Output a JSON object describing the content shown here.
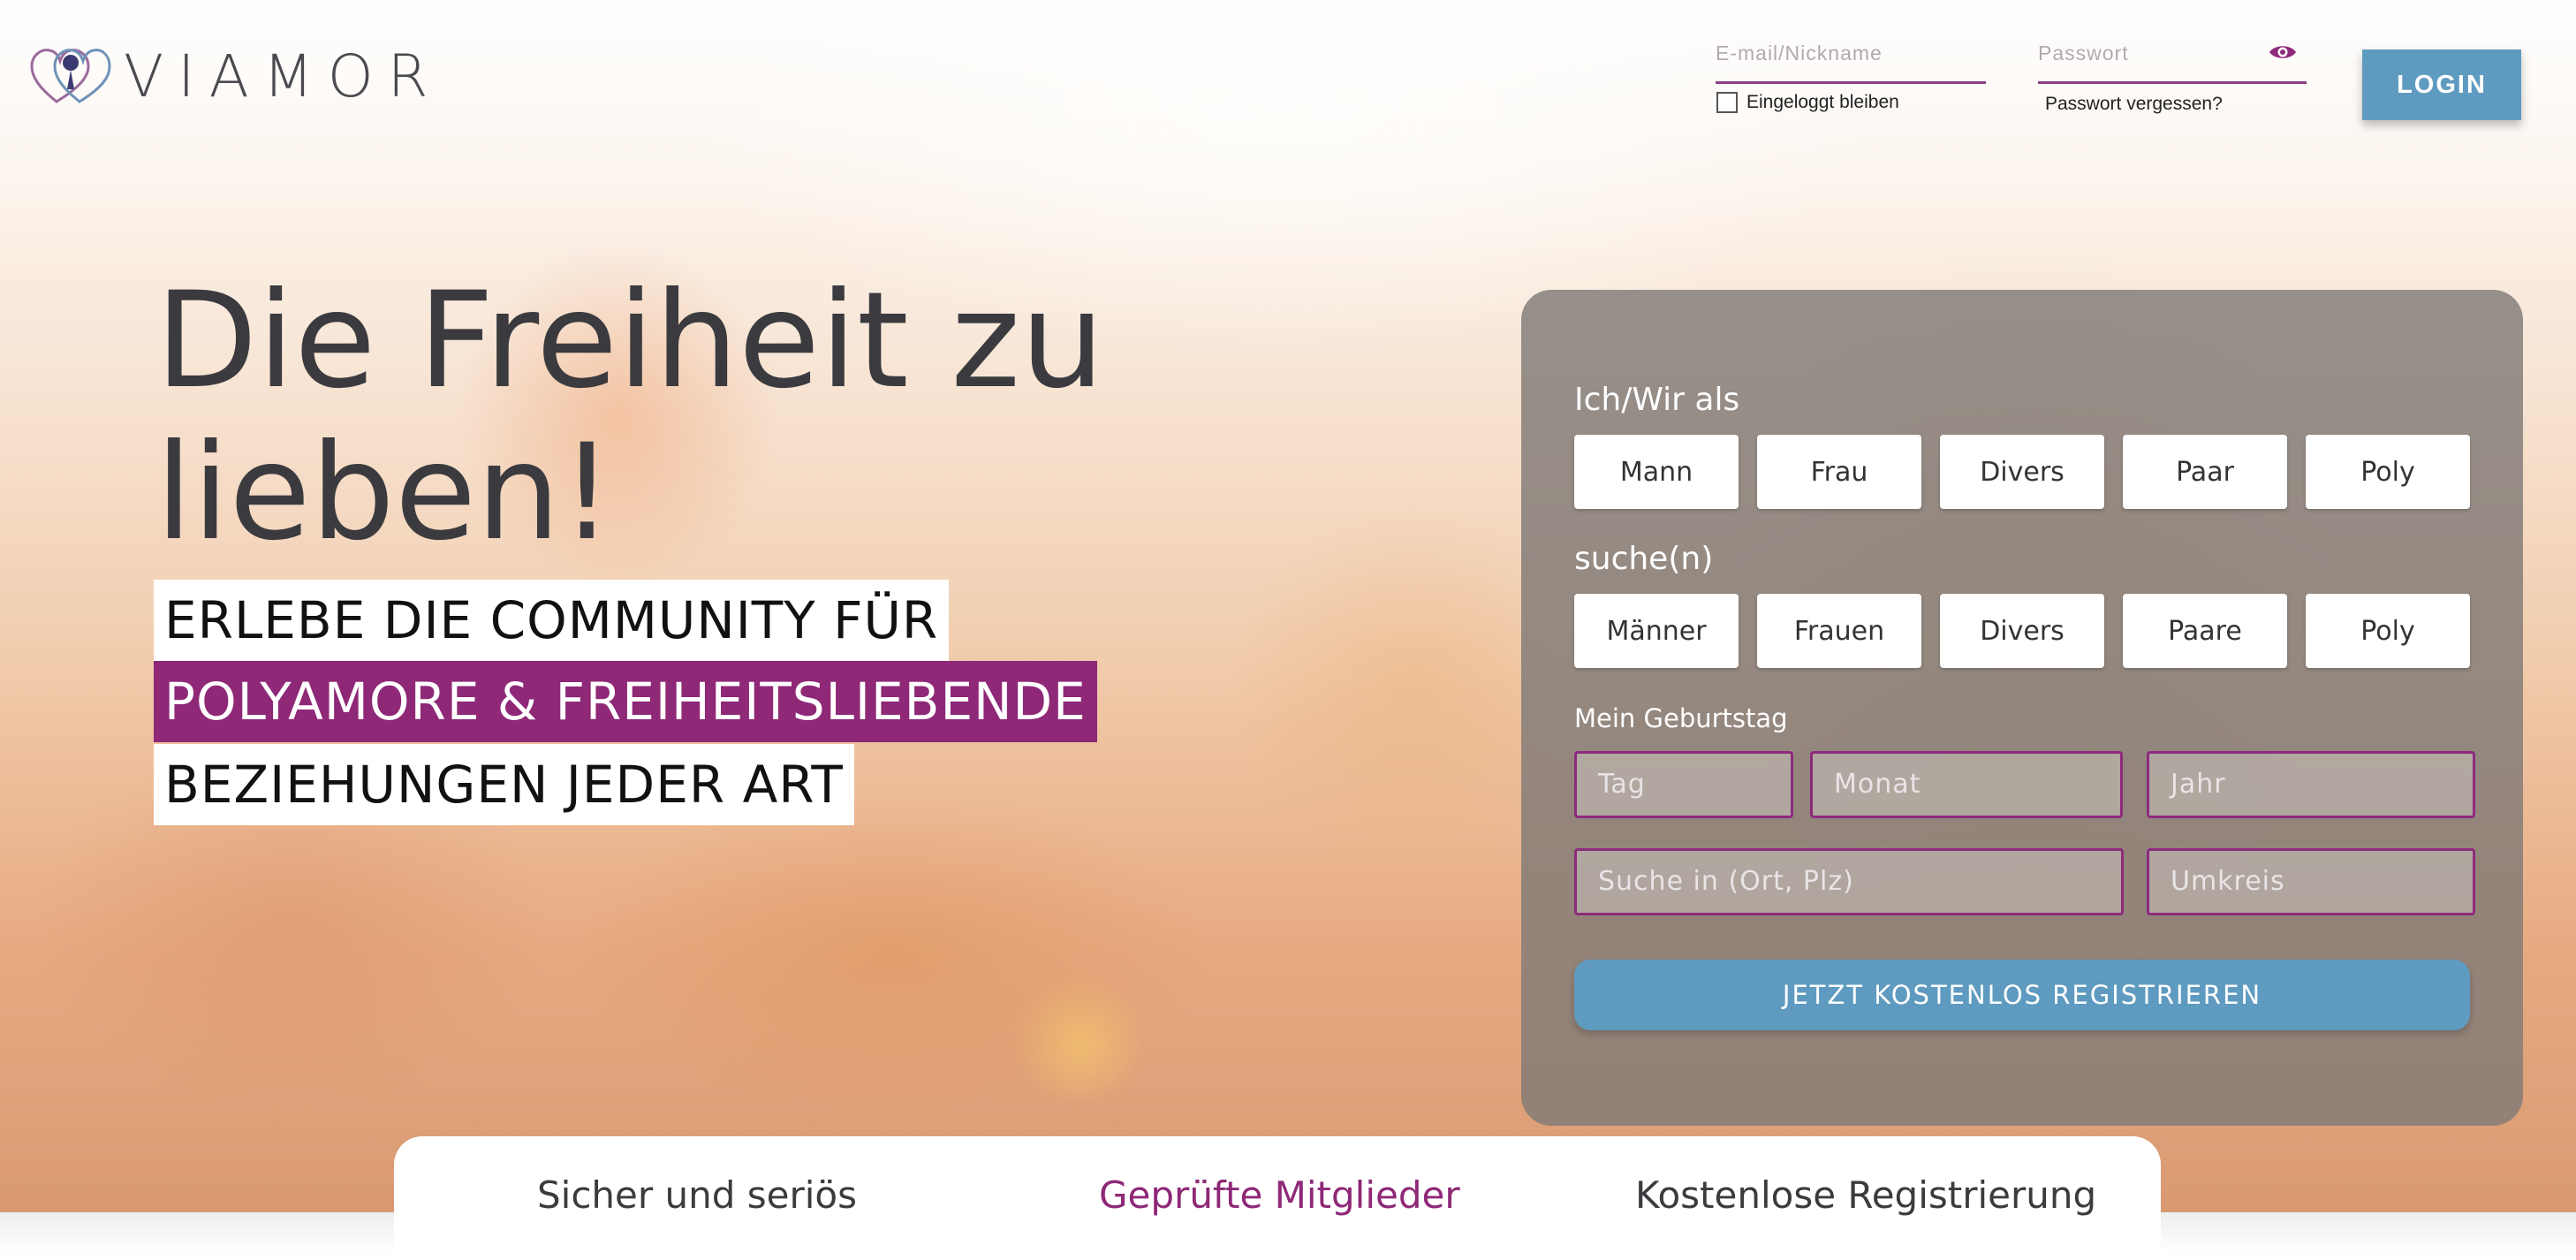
{
  "brand": {
    "name": "VIAMOR",
    "accent": "#8e2877",
    "button_color": "#5f9bc0"
  },
  "login": {
    "email_placeholder": "E-mail/Nickname",
    "password_placeholder": "Passwort",
    "remember_label": "Eingeloggt bleiben",
    "forgot_label": "Passwort vergessen?",
    "login_label": "LOGIN",
    "password_icon": "eye-icon"
  },
  "hero": {
    "headline": "Die Freiheit zu lieben!",
    "tagline_1": "ERLEBE DIE COMMUNITY FÜR",
    "tagline_2": "POLYAMORE & FREIHEITSLIEBENDE",
    "tagline_3": "BEZIEHUNGEN JEDER ART"
  },
  "register": {
    "iam_label": "Ich/Wir als",
    "iam_options": [
      "Mann",
      "Frau",
      "Divers",
      "Paar",
      "Poly"
    ],
    "seek_label": "suche(n)",
    "seek_options": [
      "Männer",
      "Frauen",
      "Divers",
      "Paare",
      "Poly"
    ],
    "birthday_label": "Mein Geburtstag",
    "day_placeholder": "Tag",
    "month_placeholder": "Monat",
    "year_placeholder": "Jahr",
    "location_placeholder": "Suche in (Ort, Plz)",
    "radius_placeholder": "Umkreis",
    "submit_label": "JETZT KOSTENLOS REGISTRIEREN"
  },
  "features": [
    "Sicher und seriös",
    "Geprüfte Mitglieder",
    "Kostenlose Registrierung"
  ]
}
